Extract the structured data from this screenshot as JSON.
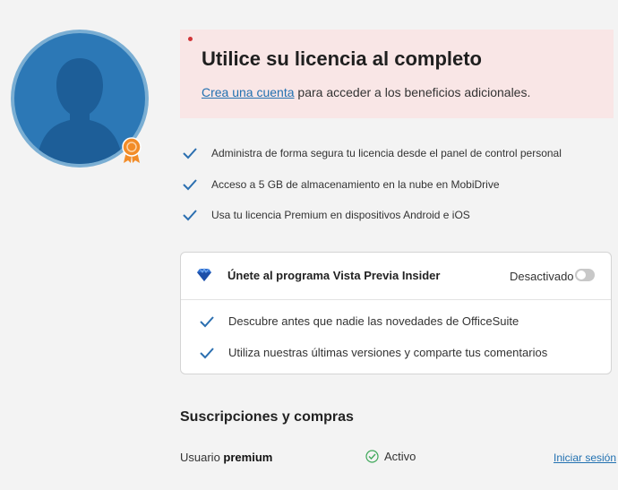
{
  "colors": {
    "accent": "#2271b1",
    "check": "#2b6fb0",
    "banner_bg": "#f9e6e6",
    "badge": "#f28c28",
    "status_ok": "#3fa85a"
  },
  "avatar": {
    "icon": "user-silhouette-icon",
    "badge_icon": "ribbon-badge-icon"
  },
  "banner": {
    "title": "Utilice su licencia al completo",
    "link": "Crea una cuenta",
    "text": " para acceder a los beneficios adicionales."
  },
  "features": [
    "Administra de forma segura tu licencia desde el panel de control personal",
    "Acceso a 5 GB de almacenamiento en la nube en MobiDrive",
    "Usa tu licencia Premium en dispositivos Android e iOS"
  ],
  "insider": {
    "icon": "diamond-icon",
    "title": "Únete al programa Vista Previa Insider",
    "toggle_label": "Desactivado",
    "toggle_on": false,
    "features": [
      "Descubre antes que nadie las novedades de OfficeSuite",
      "Utiliza nuestras últimas versiones y comparte tus comentarios"
    ]
  },
  "subscriptions": {
    "title": "Suscripciones y compras",
    "user_prefix": "Usuario ",
    "plan": "premium",
    "status": "Activo",
    "signout": "Iniciar sesión"
  }
}
